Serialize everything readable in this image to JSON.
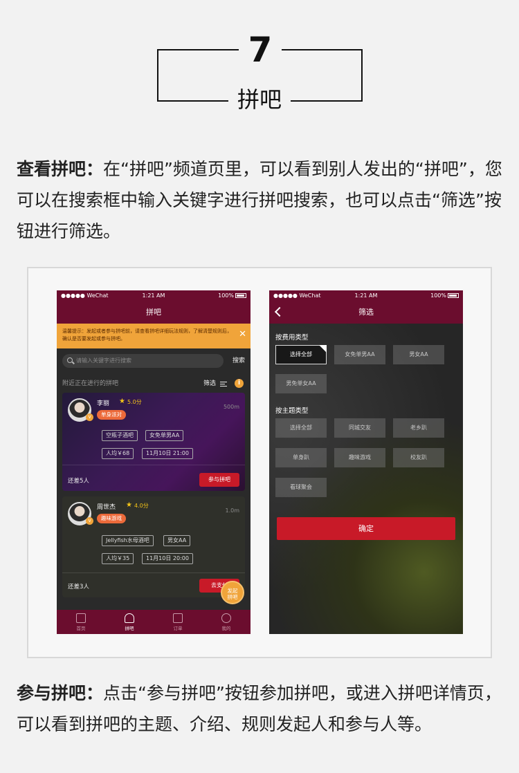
{
  "header": {
    "number": "7",
    "title": "拼吧"
  },
  "intro": {
    "heading": "查看拼吧：",
    "text": "在“拼吧”频道页里，可以看到别人发出的“拼吧”，您可以在搜索框中输入关键字进行拼吧搜索，也可以点击“筛选”按钮进行筛选。"
  },
  "outro": {
    "heading": "参与拼吧：",
    "text": "点击“参与拼吧”按钮参加拼吧，或进入拼吧详情页，可以看到拼吧的主题、介绍、规则发起人和参与人等。"
  },
  "status": {
    "carrier": "●●●●● WeChat",
    "time": "1:21 AM",
    "battery": "100%"
  },
  "list_screen": {
    "title": "拼吧",
    "notice": "温馨提示：发起或者参与拼吧前，请查看拼吧详细玩法规则，了解清楚规则后，确认是否要发起或参与拼吧。",
    "search_placeholder": "请输入关键字进行搜索",
    "search_label": "搜索",
    "nearby_label": "附近正在进行的拼吧",
    "filter_label": "筛选",
    "cards": [
      {
        "name": "李丽",
        "rating": "5.0分",
        "tag": "单身派对",
        "distance": "500m",
        "chips": [
          "空瓶子酒吧",
          "女免单男AA",
          "人均￥68",
          "11月10日  21:00"
        ],
        "remaining": "还差5人",
        "button": "参与拼吧"
      },
      {
        "name": "周世杰",
        "rating": "4.0分",
        "tag": "趣味游戏",
        "distance": "1.0m",
        "chips": [
          "Jellyfish水母酒吧",
          "男女AA",
          "人均￥35",
          "11月10日  20:00"
        ],
        "remaining": "还差3人",
        "button": "去支付"
      }
    ],
    "fab": [
      "发起",
      "拼吧"
    ],
    "tabs": [
      "首页",
      "拼吧",
      "订单",
      "我的"
    ]
  },
  "filter_screen": {
    "title": "筛选",
    "cost_section": "按费用类型",
    "cost_options": [
      "选择全部",
      "女免单男AA",
      "男女AA",
      "男免单女AA"
    ],
    "theme_section": "按主题类型",
    "theme_options": [
      "选择全部",
      "同城交友",
      "老乡趴",
      "单身趴",
      "趣味游戏",
      "校友趴",
      "看球聚会"
    ],
    "confirm": "确定"
  }
}
